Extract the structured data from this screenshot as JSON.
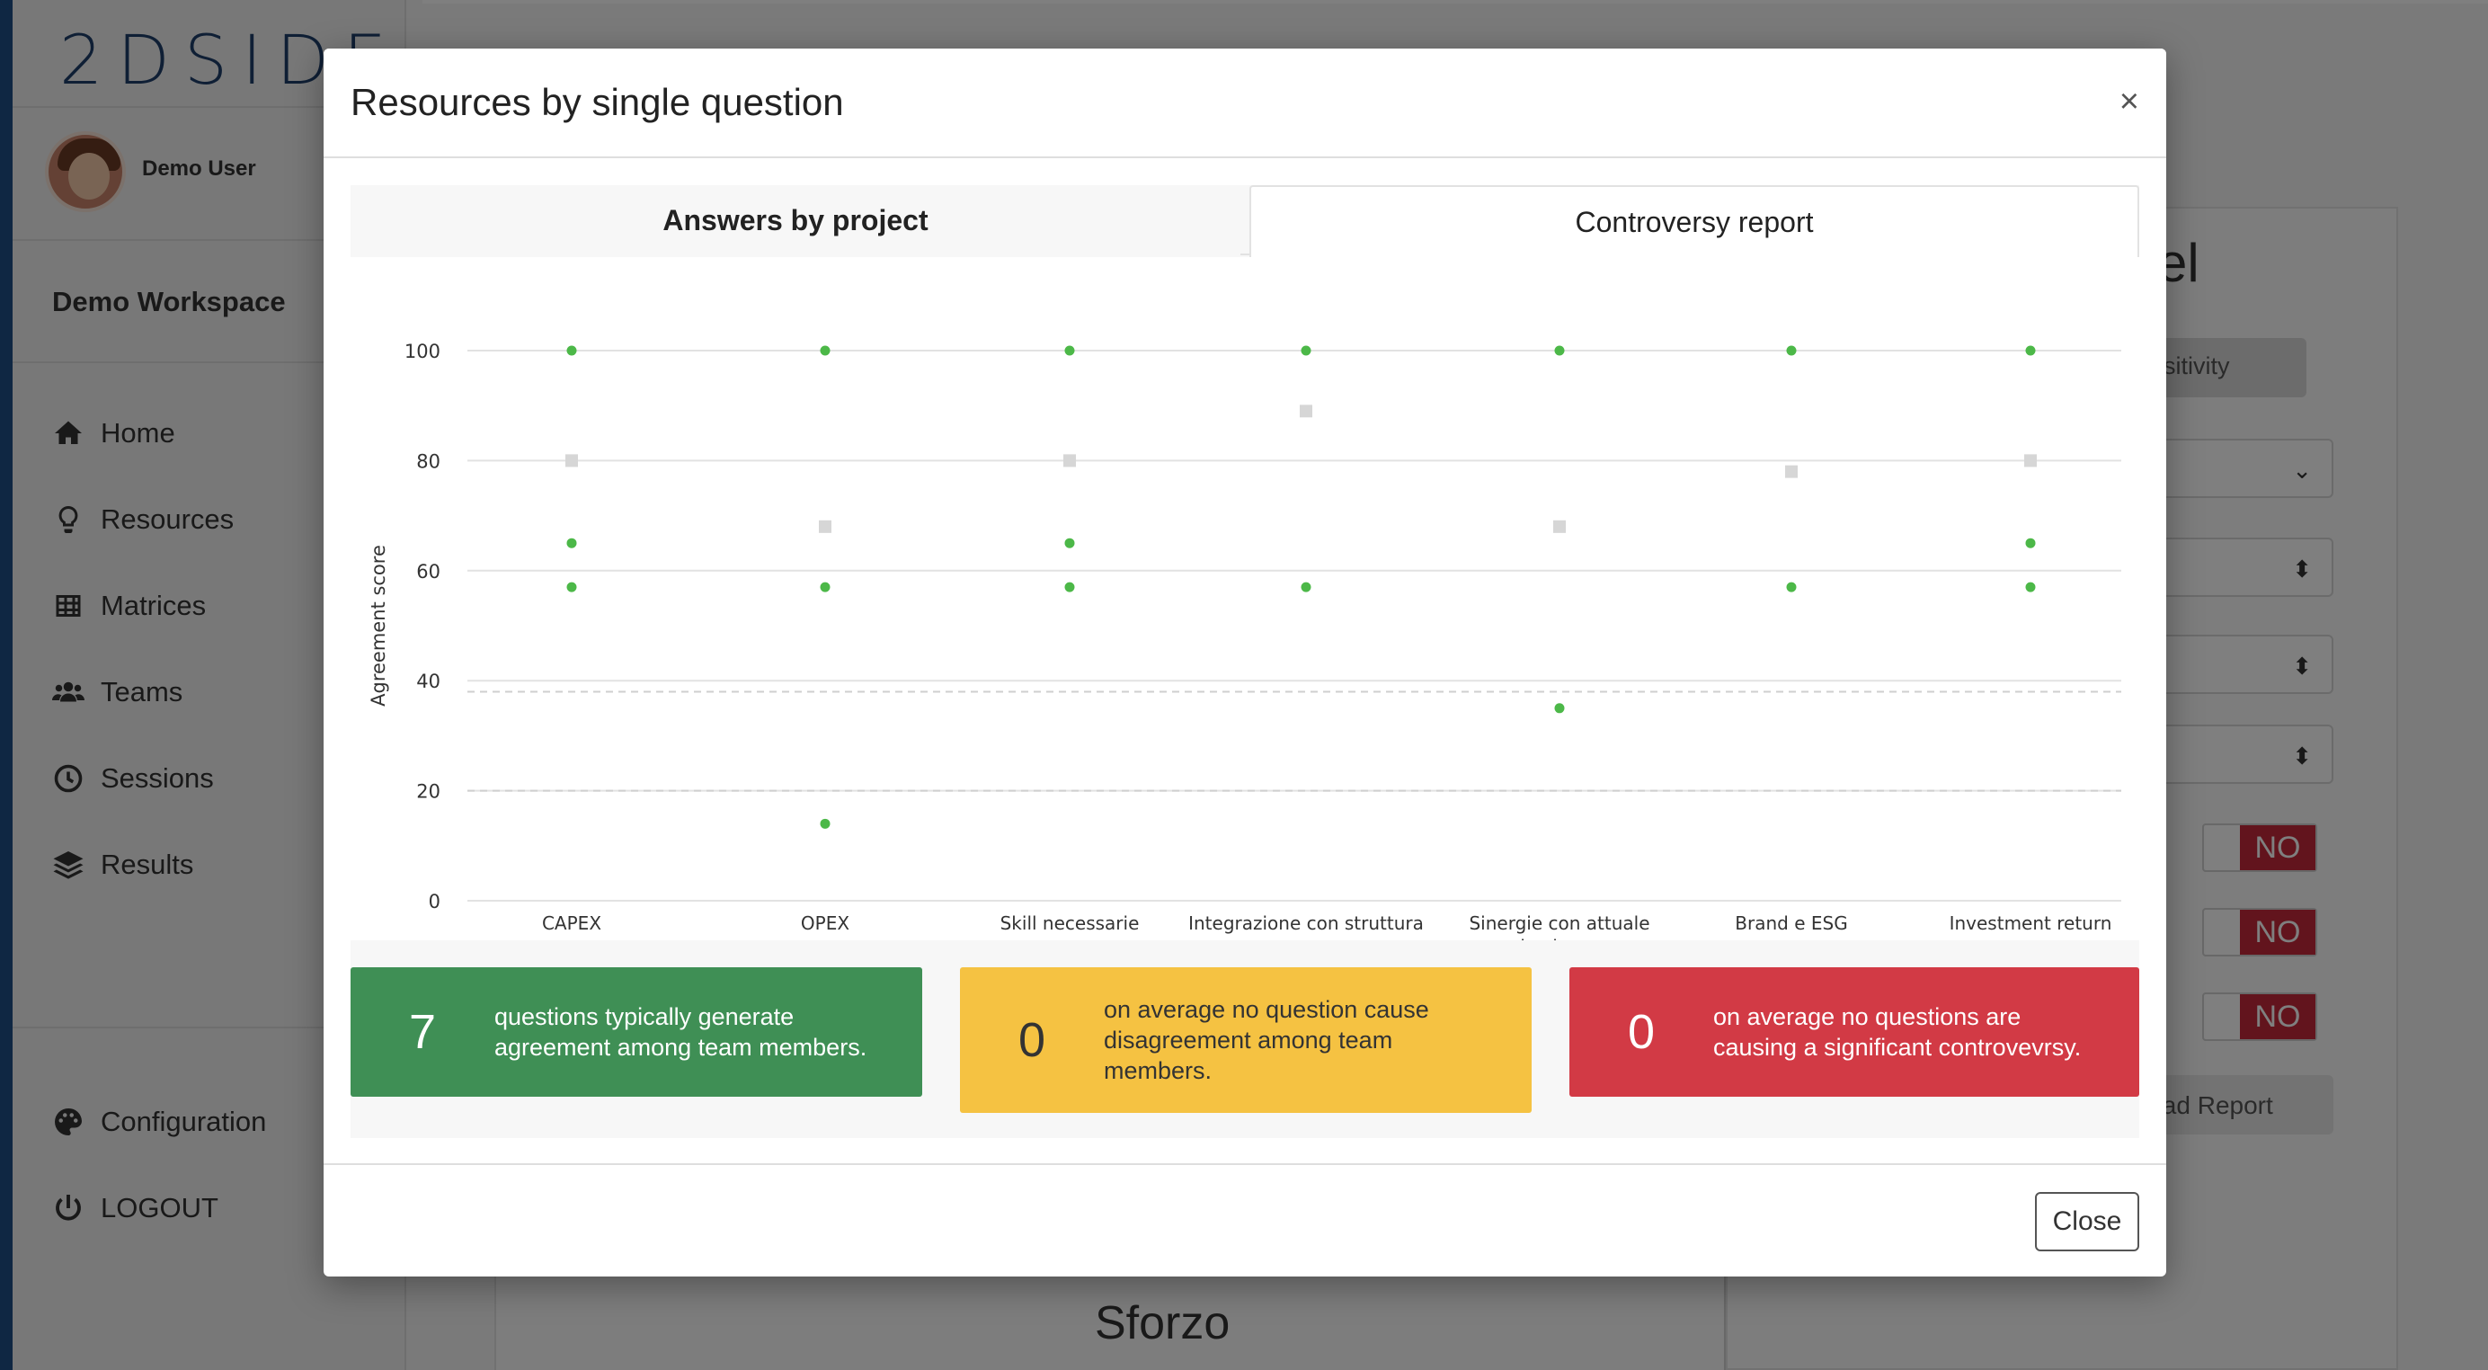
{
  "app": {
    "logo_text": "2DSIDE",
    "user_name": "Demo User",
    "workspace": "Demo Workspace",
    "nav": [
      {
        "label": "Home",
        "icon": "home-icon"
      },
      {
        "label": "Resources",
        "icon": "lightbulb-icon"
      },
      {
        "label": "Matrices",
        "icon": "table-icon"
      },
      {
        "label": "Teams",
        "icon": "users-icon"
      },
      {
        "label": "Sessions",
        "icon": "clock-icon"
      },
      {
        "label": "Results",
        "icon": "layers-icon"
      }
    ],
    "bottom_nav": [
      {
        "label": "Configuration",
        "icon": "palette-icon"
      },
      {
        "label": "LOGOUT",
        "icon": "power-icon"
      }
    ],
    "background": {
      "title_fragment": "el",
      "button_fragment": "nsitivity",
      "toggle_label": "NO",
      "download_fragment": "load Report",
      "bottom_title": "Sforzo"
    }
  },
  "modal": {
    "title": "Resources by single question",
    "close_x": "×",
    "tabs": [
      {
        "label": "Answers by project",
        "active": false
      },
      {
        "label": "Controversy report",
        "active": true
      }
    ],
    "close_button": "Close",
    "summary": [
      {
        "number": "7",
        "text": "questions typically generate agreement among team members.",
        "color": "#3f8f55"
      },
      {
        "number": "0",
        "text": "on average no question cause disagreement among team members.",
        "color": "#f5c242"
      },
      {
        "number": "0",
        "text": "on average no questions are causing a significant controvevrsy.",
        "color": "#d23a45"
      }
    ]
  },
  "chart_data": {
    "type": "scatter",
    "ylabel": "Agreement score",
    "ylim": [
      0,
      100
    ],
    "yticks": [
      0,
      20,
      40,
      60,
      80,
      100
    ],
    "reference_lines": [
      38,
      20
    ],
    "categories": [
      "CAPEX",
      "OPEX",
      "Skill necessarie",
      "Integrazione con struttura",
      "Sinergie con attuale business",
      "Brand e ESG",
      "Investment return"
    ],
    "series": [
      {
        "marker": "circle",
        "color": "#4cb848",
        "values": [
          [
            100,
            65,
            57
          ],
          [
            100,
            57,
            14
          ],
          [
            100,
            65,
            57
          ],
          [
            100,
            57
          ],
          [
            100,
            35
          ],
          [
            100,
            57
          ],
          [
            100,
            65,
            57
          ]
        ]
      },
      {
        "marker": "square",
        "color": "#d6d6d6",
        "values": [
          80,
          68,
          80,
          89,
          68,
          78,
          80
        ]
      }
    ]
  }
}
